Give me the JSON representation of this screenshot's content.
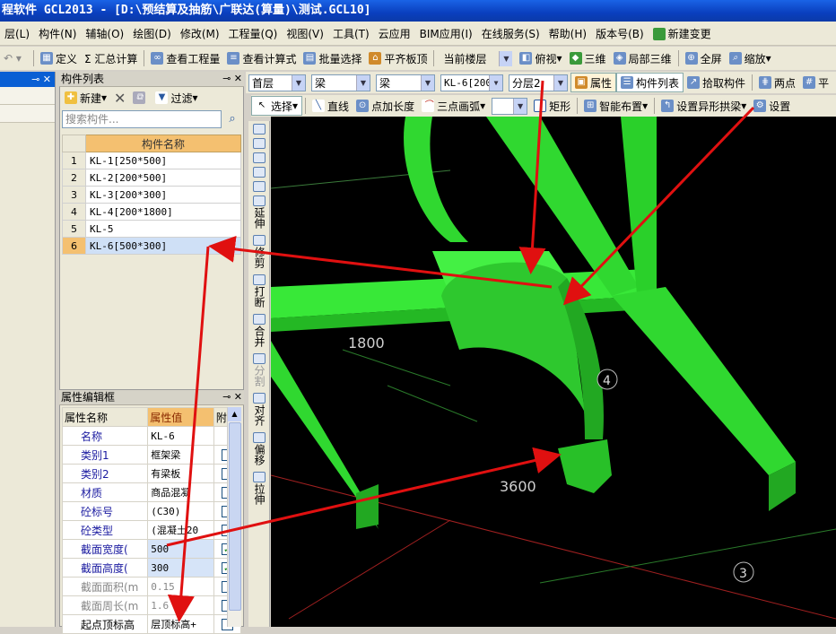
{
  "window": {
    "title": "程软件 GCL2013 - [D:\\预结算及抽筋\\广联达(算量)\\测试.GCL10]"
  },
  "menu": [
    "层(L)",
    "构件(N)",
    "辅轴(O)",
    "绘图(D)",
    "修改(M)",
    "工程量(Q)",
    "视图(V)",
    "工具(T)",
    "云应用",
    "BIM应用(I)",
    "在线服务(S)",
    "帮助(H)",
    "版本号(B)",
    "新建变更"
  ],
  "toolbar1": {
    "define": "定义",
    "sum": "Σ 汇总计算",
    "view_qty": "查看工程量",
    "view_formula": "查看计算式",
    "batch_select": "批量选择",
    "flush_top": "平齐板顶",
    "floor": "当前楼层",
    "top_view": "俯视",
    "three_d": "三维",
    "local_3d": "局部三维",
    "fullscreen": "全屏",
    "zoom": "缩放"
  },
  "toolbar2": {
    "floor": "首层",
    "cat1": "梁",
    "cat2": "梁",
    "component": "KL-6[200",
    "layer": "分层2",
    "props": "属性",
    "comp_list": "构件列表",
    "pick": "拾取构件",
    "two_points": "两点",
    "parallel": "平"
  },
  "toolbar3": {
    "select": "选择",
    "line": "直线",
    "point_len": "点加长度",
    "three_arc": "三点画弧",
    "rect": "矩形",
    "smart": "智能布置",
    "set_arch": "设置异形拱梁",
    "settings": "设置"
  },
  "component_list": {
    "title": "构件列表",
    "new": "新建",
    "filter": "过滤",
    "search_placeholder": "搜索构件...",
    "header": "构件名称",
    "rows": [
      {
        "n": "1",
        "name": "KL-1[250*500]"
      },
      {
        "n": "2",
        "name": "KL-2[200*500]"
      },
      {
        "n": "3",
        "name": "KL-3[200*300]"
      },
      {
        "n": "4",
        "name": "KL-4[200*1800]"
      },
      {
        "n": "5",
        "name": "KL-5"
      },
      {
        "n": "6",
        "name": "KL-6[500*300]"
      }
    ]
  },
  "properties": {
    "title": "属性编辑框",
    "h_name": "属性名称",
    "h_value": "属性值",
    "h_add": "附加",
    "rows": [
      {
        "name": "名称",
        "value": "KL-6"
      },
      {
        "name": "类别1",
        "value": "框架梁"
      },
      {
        "name": "类别2",
        "value": "有梁板"
      },
      {
        "name": "材质",
        "value": "商品混凝"
      },
      {
        "name": "砼标号",
        "value": "(C30)"
      },
      {
        "name": "砼类型",
        "value": "(混凝土20"
      },
      {
        "name": "截面宽度(",
        "value": "500"
      },
      {
        "name": "截面高度(",
        "value": "300"
      },
      {
        "name": "截面面积(m",
        "value": "0.15"
      },
      {
        "name": "截面周长(m",
        "value": "1.6"
      },
      {
        "name": "起点顶标高",
        "value": "层顶标高+"
      }
    ]
  },
  "vertical_tools": [
    "延伸",
    "修剪",
    "打断",
    "合并",
    "分割",
    "对齐",
    "偏移",
    "拉伸"
  ],
  "canvas": {
    "dim1": "1800",
    "dim2": "3600",
    "axis4": "4",
    "axis3": "3"
  }
}
